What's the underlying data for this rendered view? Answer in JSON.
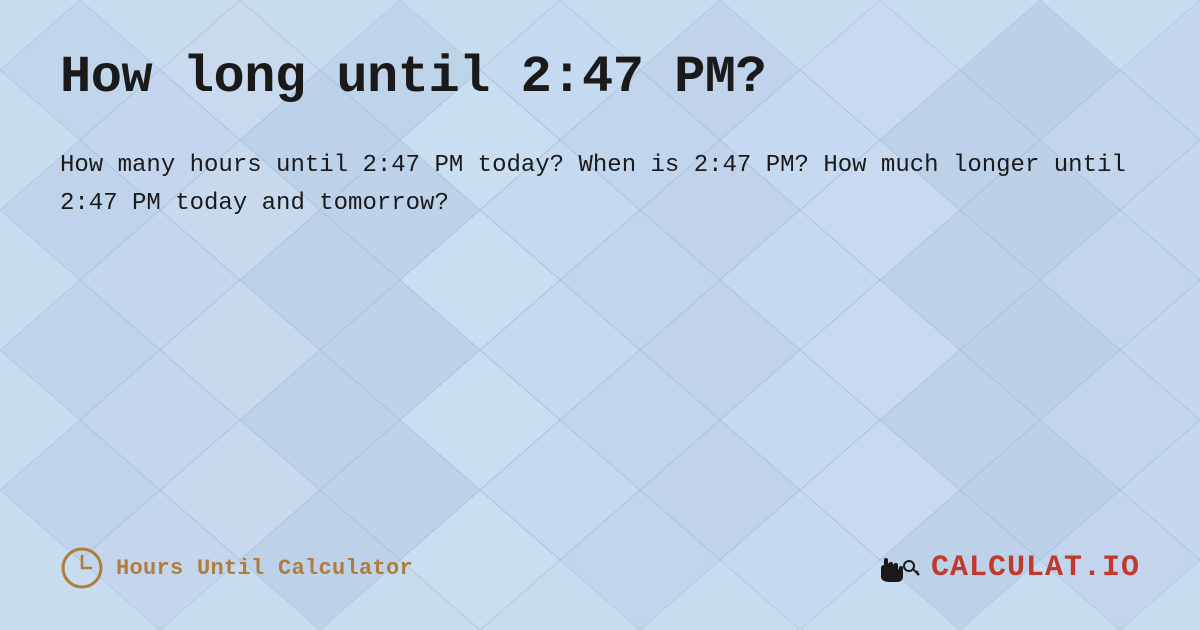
{
  "page": {
    "title": "How long until 2:47 PM?",
    "description": "How many hours until 2:47 PM today? When is 2:47 PM? How much longer until 2:47 PM today and tomorrow?",
    "footer": {
      "branding_label": "Hours Until Calculator",
      "logo_text_main": "CALCULAT",
      "logo_text_accent": ".IO"
    },
    "background": {
      "color": "#c8dcf0"
    }
  }
}
